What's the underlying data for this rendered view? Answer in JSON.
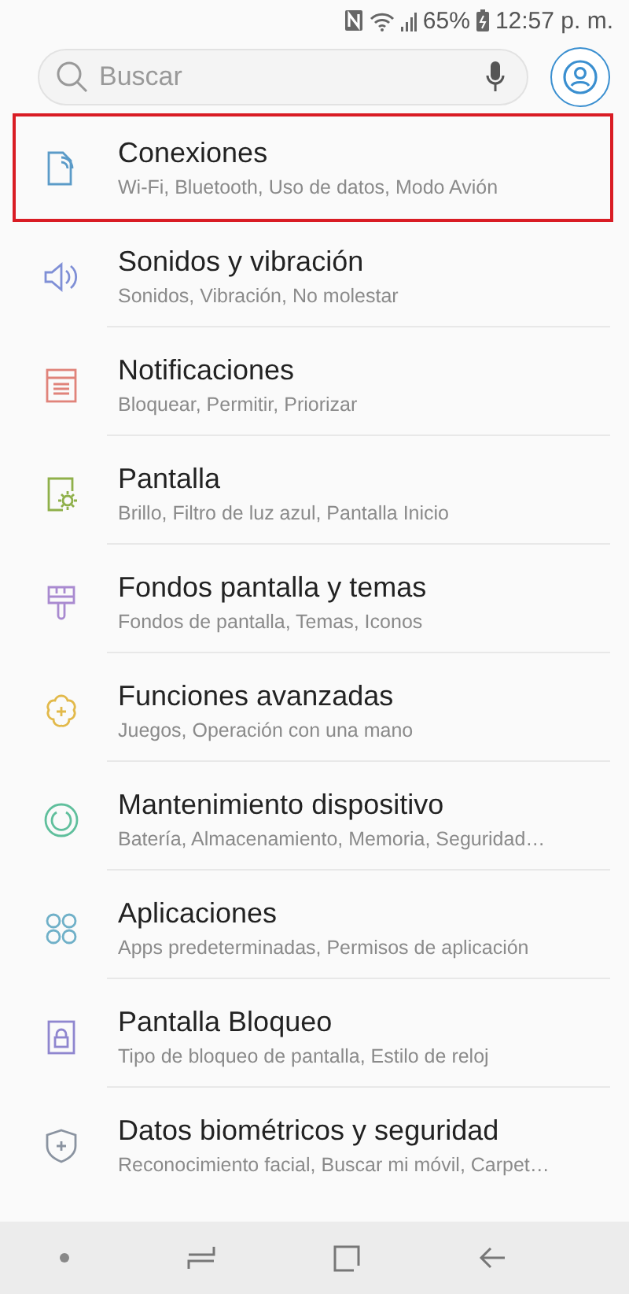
{
  "status_bar": {
    "battery": "65%",
    "time": "12:57 p. m."
  },
  "search": {
    "placeholder": "Buscar"
  },
  "items": [
    {
      "kind": "connections",
      "color": "#5b9bc8",
      "title": "Conexiones",
      "subtitle": "Wi-Fi, Bluetooth, Uso de datos, Modo Avión",
      "highlighted": true
    },
    {
      "kind": "sound",
      "color": "#7f8fd6",
      "title": "Sonidos y vibración",
      "subtitle": "Sonidos, Vibración, No molestar",
      "highlighted": false
    },
    {
      "kind": "notifications",
      "color": "#e0837a",
      "title": "Notificaciones",
      "subtitle": "Bloquear, Permitir, Priorizar",
      "highlighted": false
    },
    {
      "kind": "display",
      "color": "#8fb04a",
      "title": "Pantalla",
      "subtitle": "Brillo, Filtro de luz azul, Pantalla Inicio",
      "highlighted": false
    },
    {
      "kind": "themes",
      "color": "#a98ad0",
      "title": "Fondos pantalla y temas",
      "subtitle": "Fondos de pantalla, Temas, Iconos",
      "highlighted": false
    },
    {
      "kind": "advanced",
      "color": "#e2b94a",
      "title": "Funciones avanzadas",
      "subtitle": "Juegos, Operación con una mano",
      "highlighted": false
    },
    {
      "kind": "maintenance",
      "color": "#5fbf9c",
      "title": "Mantenimiento dispositivo",
      "subtitle": "Batería, Almacenamiento, Memoria, Seguridad…",
      "highlighted": false
    },
    {
      "kind": "apps",
      "color": "#6fb0c8",
      "title": "Aplicaciones",
      "subtitle": "Apps predeterminadas, Permisos de aplicación",
      "highlighted": false
    },
    {
      "kind": "lock",
      "color": "#8f86cf",
      "title": "Pantalla Bloqueo",
      "subtitle": "Tipo de bloqueo de pantalla, Estilo de reloj",
      "highlighted": false
    },
    {
      "kind": "security",
      "color": "#8a93a0",
      "title": "Datos biométricos y seguridad",
      "subtitle": "Reconocimiento facial, Buscar mi móvil, Carpet…",
      "highlighted": false
    }
  ]
}
